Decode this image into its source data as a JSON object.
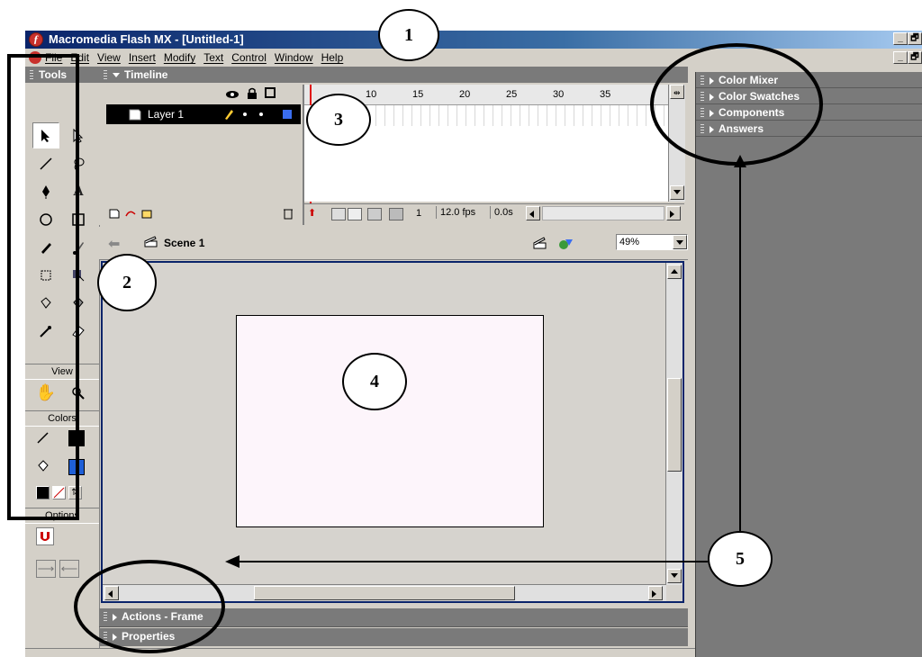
{
  "window": {
    "title": "Macromedia Flash MX - [Untitled-1]",
    "controls": [
      "_",
      "🗗"
    ]
  },
  "menu": {
    "items": [
      "File",
      "Edit",
      "View",
      "Insert",
      "Modify",
      "Text",
      "Control",
      "Window",
      "Help"
    ]
  },
  "tools_panel": {
    "title": "Tools",
    "view_label": "View",
    "colors_label": "Colors",
    "options_label": "Options",
    "stroke_color": "#000000",
    "fill_color": "#1f5fd6"
  },
  "timeline": {
    "title": "Timeline",
    "layer_name": "Layer 1",
    "ruler_ticks": [
      "10",
      "15",
      "20",
      "25",
      "30",
      "35"
    ],
    "current_frame": "1",
    "frame_rate": "12.0 fps",
    "elapsed": "0.0s"
  },
  "scene": {
    "name": "Scene 1",
    "zoom": "49%"
  },
  "bottom_panels": [
    "Actions - Frame",
    "Properties"
  ],
  "right_panels": [
    "Color Mixer",
    "Color Swatches",
    "Components",
    "Answers"
  ],
  "annotations": {
    "callouts": [
      "1",
      "2",
      "3",
      "4",
      "5"
    ]
  }
}
